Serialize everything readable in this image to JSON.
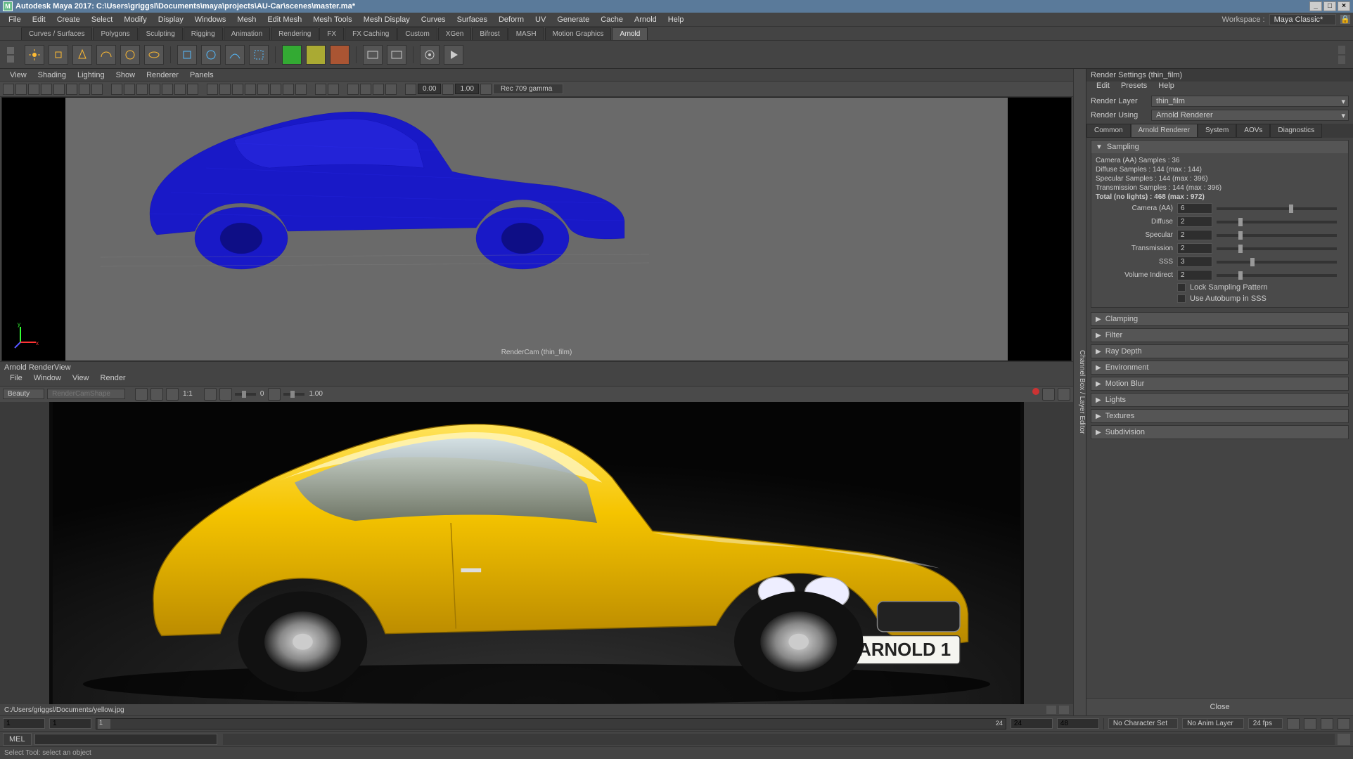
{
  "title": "Autodesk Maya 2017: C:\\Users\\griggsl\\Documents\\maya\\projects\\AU-Car\\scenes\\master.ma*",
  "workspace_label": "Workspace :",
  "workspace_value": "Maya Classic*",
  "menubar": [
    "File",
    "Edit",
    "Create",
    "Select",
    "Modify",
    "Display",
    "Windows",
    "Mesh",
    "Edit Mesh",
    "Mesh Tools",
    "Mesh Display",
    "Curves",
    "Surfaces",
    "Deform",
    "UV",
    "Generate",
    "Cache",
    "Arnold",
    "Help"
  ],
  "shelf_tabs": [
    "Curves / Surfaces",
    "Polygons",
    "Sculpting",
    "Rigging",
    "Animation",
    "Rendering",
    "FX",
    "FX Caching",
    "Custom",
    "XGen",
    "Bifrost",
    "MASH",
    "Motion Graphics",
    "Arnold"
  ],
  "shelf_active": "Arnold",
  "viewport": {
    "menu": [
      "View",
      "Shading",
      "Lighting",
      "Show",
      "Renderer",
      "Panels"
    ],
    "exposure": "0.00",
    "gamma": "1.00",
    "colorspace": "Rec 709 gamma",
    "camera_label": "RenderCam (thin_film)"
  },
  "renderview": {
    "title": "Arnold RenderView",
    "menu": [
      "File",
      "Window",
      "View",
      "Render"
    ],
    "layer": "Beauty",
    "camera": "RenderCamShape",
    "ratio": "1:1",
    "val1": "0",
    "val2": "1.00",
    "status_path": "C:/Users/griggsl/Documents/yellow.jpg",
    "plate_text": "ARNOLD 1"
  },
  "timeline": {
    "start_range": "1",
    "start": "1",
    "current": "1",
    "end_vis": "24",
    "end": "24",
    "end_range": "48",
    "charset": "No Character Set",
    "animlayer": "No Anim Layer",
    "fps": "24 fps"
  },
  "cmd_label": "MEL",
  "status_text": "Select Tool: select an object",
  "render_settings": {
    "title": "Render Settings (thin_film)",
    "menu": [
      "Edit",
      "Presets",
      "Help"
    ],
    "layer_label": "Render Layer",
    "layer_value": "thin_film",
    "using_label": "Render Using",
    "using_value": "Arnold Renderer",
    "tabs": [
      "Common",
      "Arnold Renderer",
      "System",
      "AOVs",
      "Diagnostics"
    ],
    "active_tab": "Arnold Renderer",
    "sampling": {
      "title": "Sampling",
      "info": [
        "Camera (AA) Samples : 36",
        "Diffuse Samples : 144 (max : 144)",
        "Specular Samples : 144 (max : 396)",
        "Transmission Samples : 144 (max : 396)",
        "Total (no lights) : 468 (max : 972)"
      ],
      "params": [
        {
          "label": "Camera (AA)",
          "value": "6",
          "pos": 60
        },
        {
          "label": "Diffuse",
          "value": "2",
          "pos": 18
        },
        {
          "label": "Specular",
          "value": "2",
          "pos": 18
        },
        {
          "label": "Transmission",
          "value": "2",
          "pos": 18
        },
        {
          "label": "SSS",
          "value": "3",
          "pos": 28
        },
        {
          "label": "Volume Indirect",
          "value": "2",
          "pos": 18
        }
      ],
      "lock_label": "Lock Sampling Pattern",
      "autobump_label": "Use Autobump in SSS"
    },
    "collapsed_sections": [
      "Clamping",
      "Filter",
      "Ray Depth",
      "Environment",
      "Motion Blur",
      "Lights",
      "Textures",
      "Subdivision"
    ],
    "close": "Close"
  }
}
